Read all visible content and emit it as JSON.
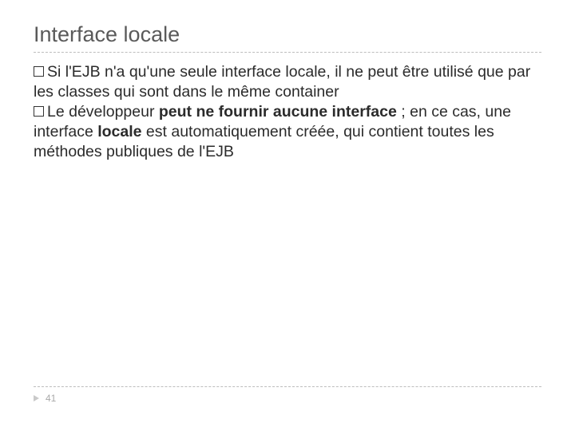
{
  "slide": {
    "title": "Interface locale",
    "bullets": [
      {
        "t1": "Si l'EJB n'a qu'une seule interface locale, il ne peut être utilisé que par les classes qui sont dans le même container"
      },
      {
        "t1": "Le développeur ",
        "b1": "peut ne fournir aucune interface",
        "t2": " ; en ce cas, une interface ",
        "b2": "locale",
        "t3": " est automatiquement créée, qui contient toutes les méthodes publiques de l'EJB"
      }
    ],
    "page_number": "41"
  }
}
